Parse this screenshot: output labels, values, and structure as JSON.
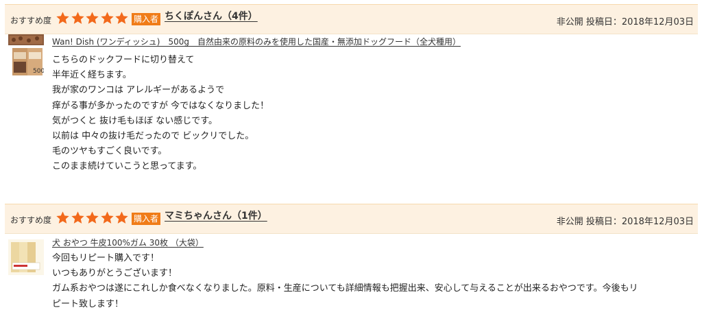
{
  "reviews": [
    {
      "rec_label": "おすすめ度",
      "rating": 5,
      "buyer_badge": "購入者",
      "reviewer": "ちくぽんさん（4件）",
      "date": "非公開 投稿日：2018年12月03日",
      "product_thumb_text": "500g",
      "product": "Wan! Dish (ワンディッシュ)　500g　自然由来の原料のみを使用した国産・無添加ドッグフード（全犬種用）",
      "body": [
        "こちらのドックフードに切り替えて",
        "半年近く経ちます。",
        "我が家のワンコは アレルギーがあるようで",
        "痒がる事が多かったのですが 今ではなくなりました！",
        "気がつくと 抜け毛もほぼ ない感じです。",
        "以前は 中々の抜け毛だったので ビックリでした。",
        "毛のツヤもすごく良いです。",
        "このまま続けていこうと思ってます。"
      ]
    },
    {
      "rec_label": "おすすめ度",
      "rating": 5,
      "buyer_badge": "購入者",
      "reviewer": "マミちゃんさん（1件）",
      "date": "非公開 投稿日：2018年12月03日",
      "product": "犬 おやつ 牛皮100%ガム 30枚 （大袋）",
      "body": [
        "今回もリピート購入です！",
        "いつもありがとうございます！",
        "ガム系おやつは遂にこれしか食べなくなりました。原料・生産についても詳細情報も把握出来、安心して与えることが出来るおやつです。今後もリ",
        "ピート致します！"
      ]
    }
  ],
  "colors": {
    "header_bg": "#fdf1e1",
    "star": "#f2691b",
    "badge": "#f07c18"
  },
  "icons": [
    "star-icon",
    "product-image-dogfood",
    "product-image-chew"
  ]
}
